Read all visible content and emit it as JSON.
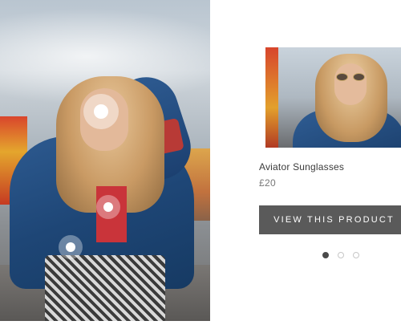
{
  "hero": {
    "image_alt": "Woman in denim jacket at fairground"
  },
  "hotspots": [
    {
      "name": "hotspot-sunglasses",
      "active": true
    },
    {
      "name": "hotspot-top",
      "active": false
    },
    {
      "name": "hotspot-jacket",
      "active": false
    }
  ],
  "product": {
    "name": "Aviator Sunglasses",
    "price": "£20",
    "button_label": "VIEW THIS PRODUCT"
  },
  "pager": {
    "total": 3,
    "active_index": 0
  },
  "colors": {
    "button_bg": "#5a5a5a",
    "pager_active": "#4a4a4a"
  }
}
